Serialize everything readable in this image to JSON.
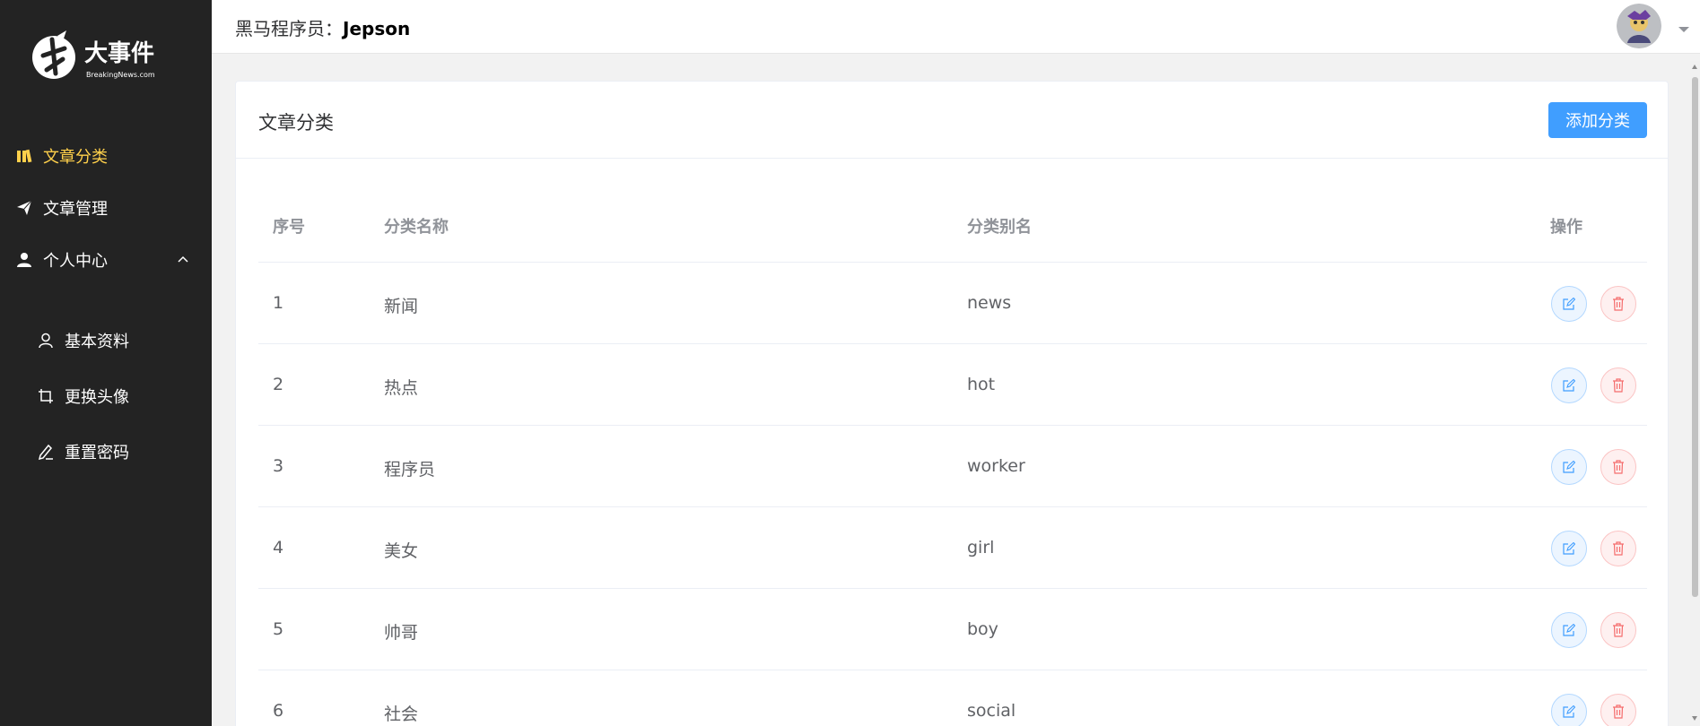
{
  "logo": {
    "title": "大事件",
    "subtitle": "BreakingNews.com"
  },
  "sidebar": {
    "items": [
      {
        "label": "文章分类",
        "icon": "category-icon",
        "active": true
      },
      {
        "label": "文章管理",
        "icon": "paper-plane-icon"
      },
      {
        "label": "个人中心",
        "icon": "user-filled-icon",
        "expanded": true
      }
    ],
    "sub_items": [
      {
        "label": "基本资料",
        "icon": "user-outline-icon"
      },
      {
        "label": "更换头像",
        "icon": "crop-icon"
      },
      {
        "label": "重置密码",
        "icon": "edit-pen-icon"
      }
    ]
  },
  "header": {
    "user_prefix": "黑马程序员：",
    "user_name": "Jepson"
  },
  "card": {
    "title": "文章分类",
    "add_button": "添加分类"
  },
  "table": {
    "headers": [
      "序号",
      "分类名称",
      "分类别名",
      "操作"
    ],
    "rows": [
      {
        "index": "1",
        "name": "新闻",
        "alias": "news"
      },
      {
        "index": "2",
        "name": "热点",
        "alias": "hot"
      },
      {
        "index": "3",
        "name": "程序员",
        "alias": "worker"
      },
      {
        "index": "4",
        "name": "美女",
        "alias": "girl"
      },
      {
        "index": "5",
        "name": "帅哥",
        "alias": "boy"
      },
      {
        "index": "6",
        "name": "社会",
        "alias": "social"
      }
    ]
  },
  "colors": {
    "sidebar_bg": "#232323",
    "active_menu": "#ffd04b",
    "primary": "#409eff",
    "danger": "#f56c6c"
  }
}
